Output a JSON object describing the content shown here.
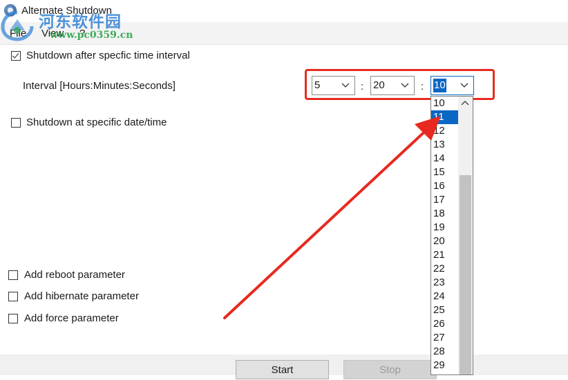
{
  "window": {
    "title": "Alternate Shutdown"
  },
  "watermark": {
    "text_cn": "河东软件园",
    "url": "www.pc0359.cn"
  },
  "menu": {
    "items": [
      "File",
      "View",
      "?"
    ]
  },
  "interval_option": {
    "label": "Shutdown after specfic time interval",
    "checked": true
  },
  "interval": {
    "label": "Interval [Hours:Minutes:Seconds]",
    "hours": "5",
    "minutes": "20",
    "seconds": "10",
    "separator": ":"
  },
  "datetime_option": {
    "label": "Shutdown at specific date/time",
    "checked": false
  },
  "seconds_dropdown": {
    "options": [
      "10",
      "11",
      "12",
      "13",
      "14",
      "15",
      "16",
      "17",
      "18",
      "19",
      "20",
      "21",
      "22",
      "23",
      "24",
      "25",
      "26",
      "27",
      "28",
      "29"
    ],
    "highlighted": "11"
  },
  "params": [
    {
      "label": "Add reboot parameter",
      "checked": false
    },
    {
      "label": "Add hibernate parameter",
      "checked": false
    },
    {
      "label": "Add force parameter",
      "checked": false
    }
  ],
  "buttons": {
    "start": "Start",
    "stop": "Stop"
  },
  "colors": {
    "annotation_red": "#e8291f",
    "selection_blue": "#0a67c4"
  }
}
